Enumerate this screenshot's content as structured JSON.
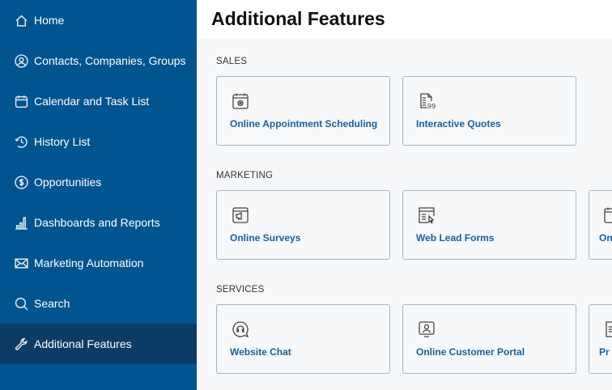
{
  "sidebar": {
    "items": [
      {
        "label": "Home",
        "icon": "home-icon"
      },
      {
        "label": "Contacts, Companies, Groups",
        "icon": "user-circle-icon"
      },
      {
        "label": "Calendar and Task List",
        "icon": "calendar-icon"
      },
      {
        "label": "History List",
        "icon": "history-icon"
      },
      {
        "label": "Opportunities",
        "icon": "dollar-circle-icon"
      },
      {
        "label": "Dashboards and Reports",
        "icon": "bar-chart-icon"
      },
      {
        "label": "Marketing Automation",
        "icon": "envelope-icon"
      },
      {
        "label": "Search",
        "icon": "search-icon"
      },
      {
        "label": "Additional Features",
        "icon": "wrench-icon",
        "active": true
      }
    ]
  },
  "header": {
    "title": "Additional Features"
  },
  "sections": [
    {
      "title": "SALES",
      "cards": [
        {
          "label": "Online Appointment Scheduling",
          "icon": "calendar-gear-icon"
        },
        {
          "label": "Interactive Quotes",
          "icon": "quote-document-icon"
        }
      ]
    },
    {
      "title": "MARKETING",
      "cards": [
        {
          "label": "Online Surveys",
          "icon": "survey-browser-icon"
        },
        {
          "label": "Web Lead Forms",
          "icon": "web-form-icon"
        },
        {
          "label": "On",
          "icon": "calendar-icon"
        }
      ]
    },
    {
      "title": "SERVICES",
      "cards": [
        {
          "label": "Website Chat",
          "icon": "chat-headset-icon"
        },
        {
          "label": "Online Customer Portal",
          "icon": "customer-portal-icon"
        },
        {
          "label": "Pr",
          "icon": "document-icon"
        }
      ]
    }
  ],
  "colors": {
    "sidebar": "#00548f",
    "sidebar_active": "#0c3b66",
    "link": "#1b5f9a"
  }
}
